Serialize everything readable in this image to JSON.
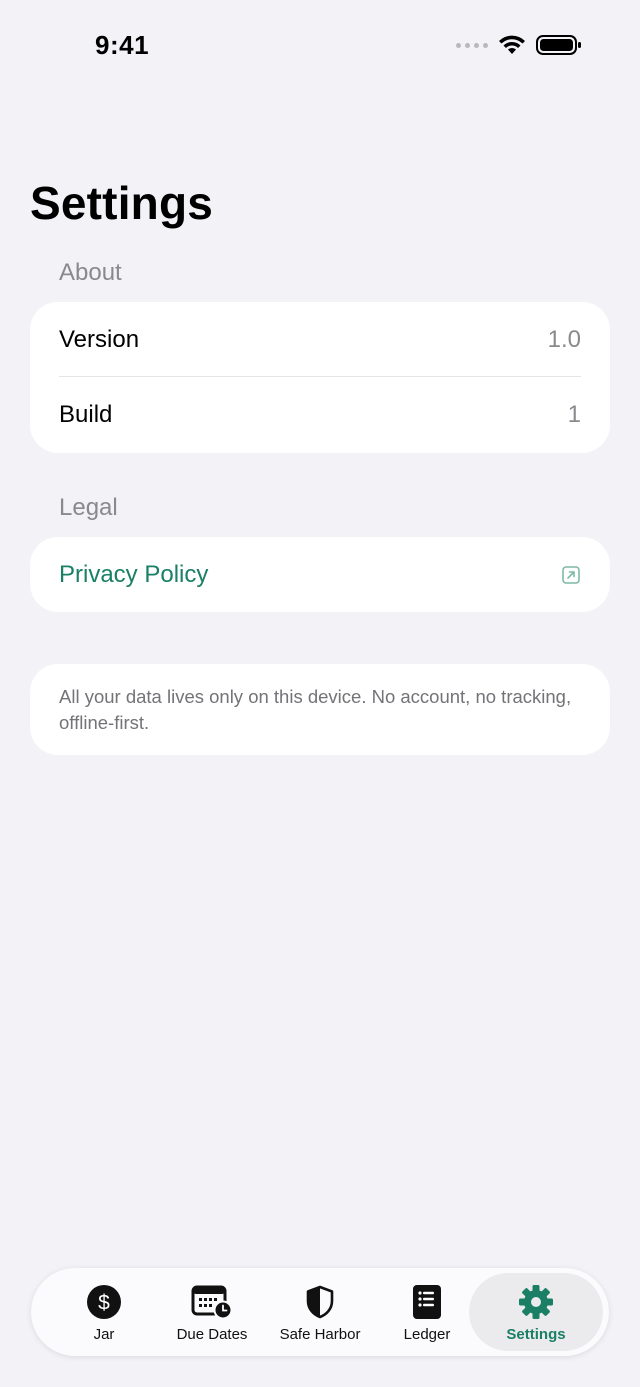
{
  "status_bar": {
    "time": "9:41"
  },
  "page": {
    "title": "Settings"
  },
  "sections": {
    "about": {
      "header": "About",
      "rows": [
        {
          "label": "Version",
          "value": "1.0"
        },
        {
          "label": "Build",
          "value": "1"
        }
      ]
    },
    "legal": {
      "header": "Legal",
      "privacy_label": "Privacy Policy",
      "link_icon": "external-link-icon"
    },
    "note": {
      "text": "All your data lives only on this device. No account, no tracking, offline-first."
    }
  },
  "tabbar": {
    "active": "Settings",
    "items": [
      {
        "label": "Jar",
        "icon": "dollar-circle-icon"
      },
      {
        "label": "Due Dates",
        "icon": "calendar-clock-icon"
      },
      {
        "label": "Safe Harbor",
        "icon": "shield-icon"
      },
      {
        "label": "Ledger",
        "icon": "list-book-icon"
      },
      {
        "label": "Settings",
        "icon": "gear-icon"
      }
    ]
  },
  "colors": {
    "background": "#f2f2f7",
    "accent": "#1a8065",
    "secondary_text": "#8a8a8e"
  }
}
